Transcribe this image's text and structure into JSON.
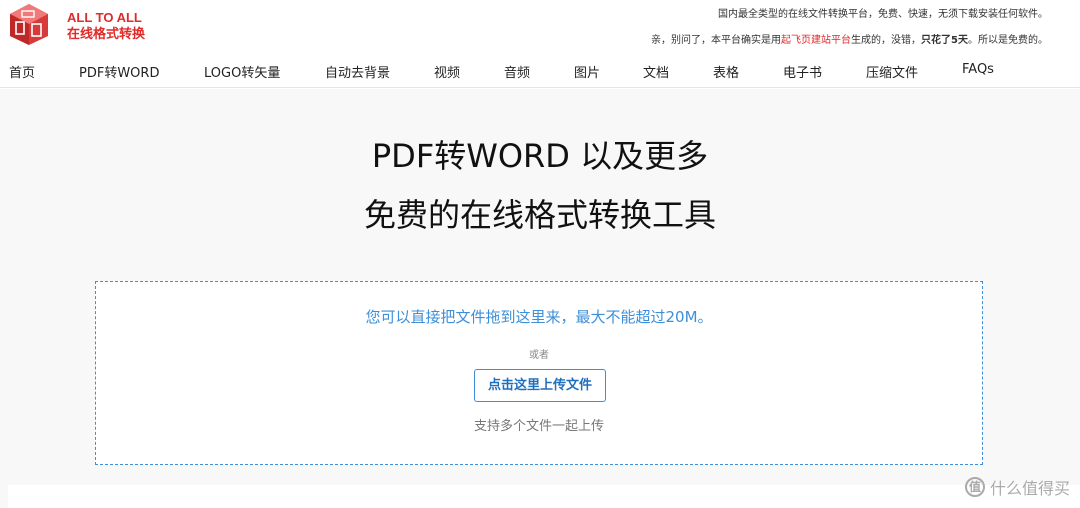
{
  "brand": {
    "name_en": "ALL TO ALL",
    "name_cn": "在线格式转换"
  },
  "header": {
    "tagline": "国内最全类型的在线文件转换平台，免费、快速，无须下载安装任何软件。",
    "notice_part1": "亲，别问了，本平台确实是用",
    "notice_link": "起飞页建站平台",
    "notice_part2": "生成的，没错，",
    "notice_bold": "只花了5天",
    "notice_part3": "。所以是免费的。"
  },
  "nav": {
    "items": [
      {
        "label": "首页"
      },
      {
        "label": "PDF转WORD"
      },
      {
        "label": "LOGO转矢量"
      },
      {
        "label": "自动去背景"
      },
      {
        "label": "视频"
      },
      {
        "label": "音频"
      },
      {
        "label": "图片"
      },
      {
        "label": "文档"
      },
      {
        "label": "表格"
      },
      {
        "label": "电子书"
      },
      {
        "label": "压缩文件"
      },
      {
        "label": "FAQs"
      }
    ]
  },
  "hero": {
    "title_line1": "PDF转WORD 以及更多",
    "title_line2": "免费的在线格式转换工具"
  },
  "upload": {
    "drop_hint": "您可以直接把文件拖到这里来，最大不能超过20M。",
    "or_text": "或者",
    "button_label": "点击这里上传文件",
    "multi_hint": "支持多个文件一起上传"
  },
  "watermark": {
    "icon_text": "值",
    "text": "什么值得买"
  },
  "colors": {
    "brand_red": "#e02b2b",
    "accent_blue": "#3d8fd9"
  }
}
